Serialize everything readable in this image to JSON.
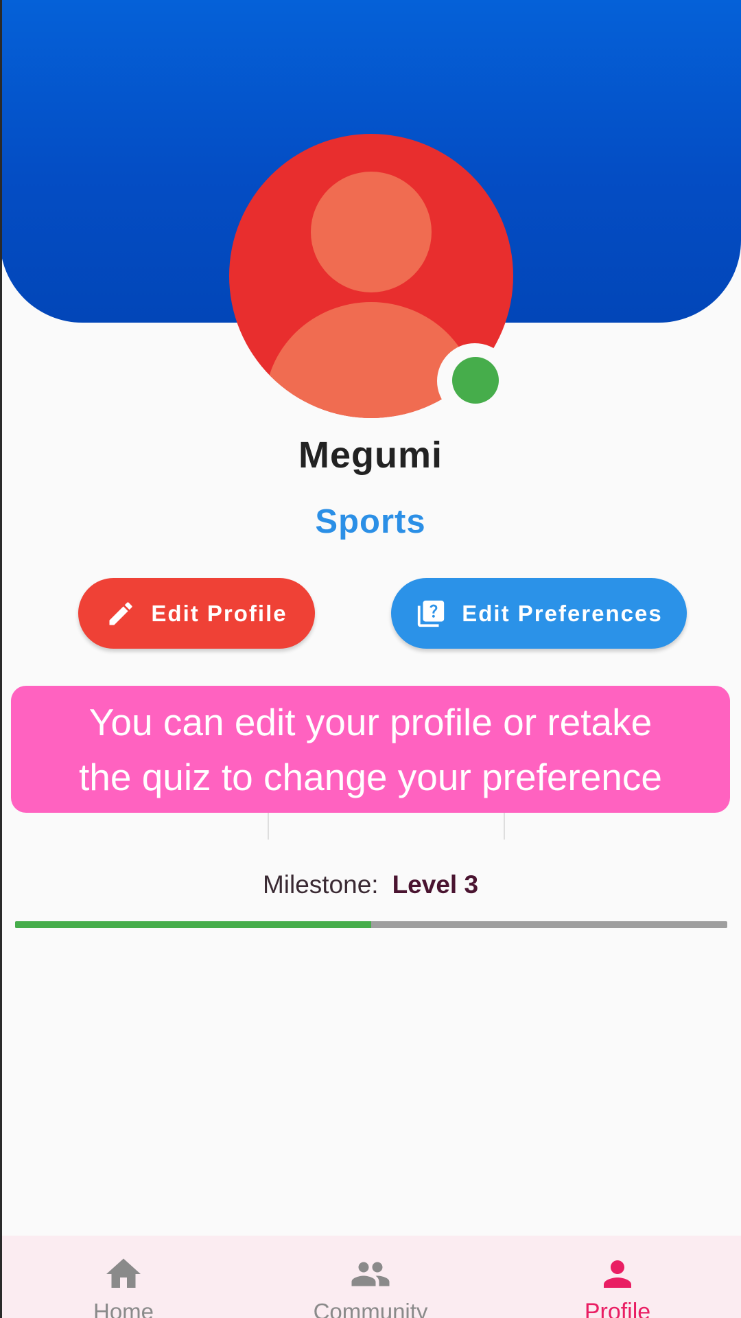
{
  "profile": {
    "name": "Megumi",
    "category": "Sports",
    "status": "online"
  },
  "actions": {
    "edit_profile_label": "Edit Profile",
    "edit_preferences_label": "Edit Preferences"
  },
  "tooltip": {
    "line1": "You can edit your profile or retake",
    "line2": "the quiz to change your preference"
  },
  "milestone": {
    "label": "Milestone:",
    "level": "Level 3",
    "progress_fraction": 0.5
  },
  "bottom_nav": {
    "items": [
      {
        "label": "Home",
        "icon": "home-icon",
        "active": false
      },
      {
        "label": "Community",
        "icon": "community-icon",
        "active": false
      },
      {
        "label": "Profile",
        "icon": "person-icon",
        "active": true
      }
    ]
  },
  "colors": {
    "header_blue": "#0561d8",
    "avatar_red": "#e82e2e",
    "online_green": "#46ad4b",
    "edit_button_red": "#ef4136",
    "preferences_button_blue": "#2b92e8",
    "category_blue": "#2b8fe6",
    "tooltip_pink": "#ff62c0",
    "nav_active_pink": "#e91e63",
    "nav_inactive_gray": "#8a8a8a"
  }
}
